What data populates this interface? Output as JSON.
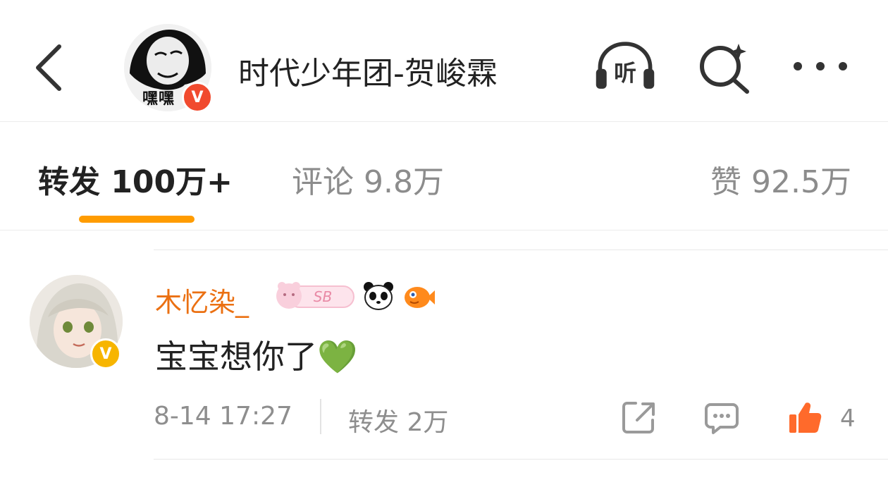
{
  "header": {
    "title": "时代少年团-贺峻霖",
    "avatar_caption": "嘿嘿",
    "verified_mark": "V",
    "listen_label": "听"
  },
  "tabs": {
    "reposts": "转发 100万+",
    "comments": "评论 9.8万",
    "likes": "赞 92.5万"
  },
  "comment": {
    "username": "木忆染_",
    "verified_mark": "V",
    "badge_text": "SB",
    "text": "宝宝想你了💚",
    "time": "8-14 17:27",
    "repost_label": "转发 2万",
    "like_count": "4"
  },
  "colors": {
    "accent": "#ff9c00",
    "username": "#eb7012",
    "verified_red": "#f14a2e",
    "verified_gold": "#f7b500",
    "like_orange": "#ff6a2b"
  },
  "icons": [
    "back-arrow-icon",
    "headphones-listen-icon",
    "sparkle-search-icon",
    "more-dots-icon",
    "share-icon",
    "comment-icon",
    "thumbs-up-icon",
    "panda-icon",
    "fish-icon"
  ]
}
